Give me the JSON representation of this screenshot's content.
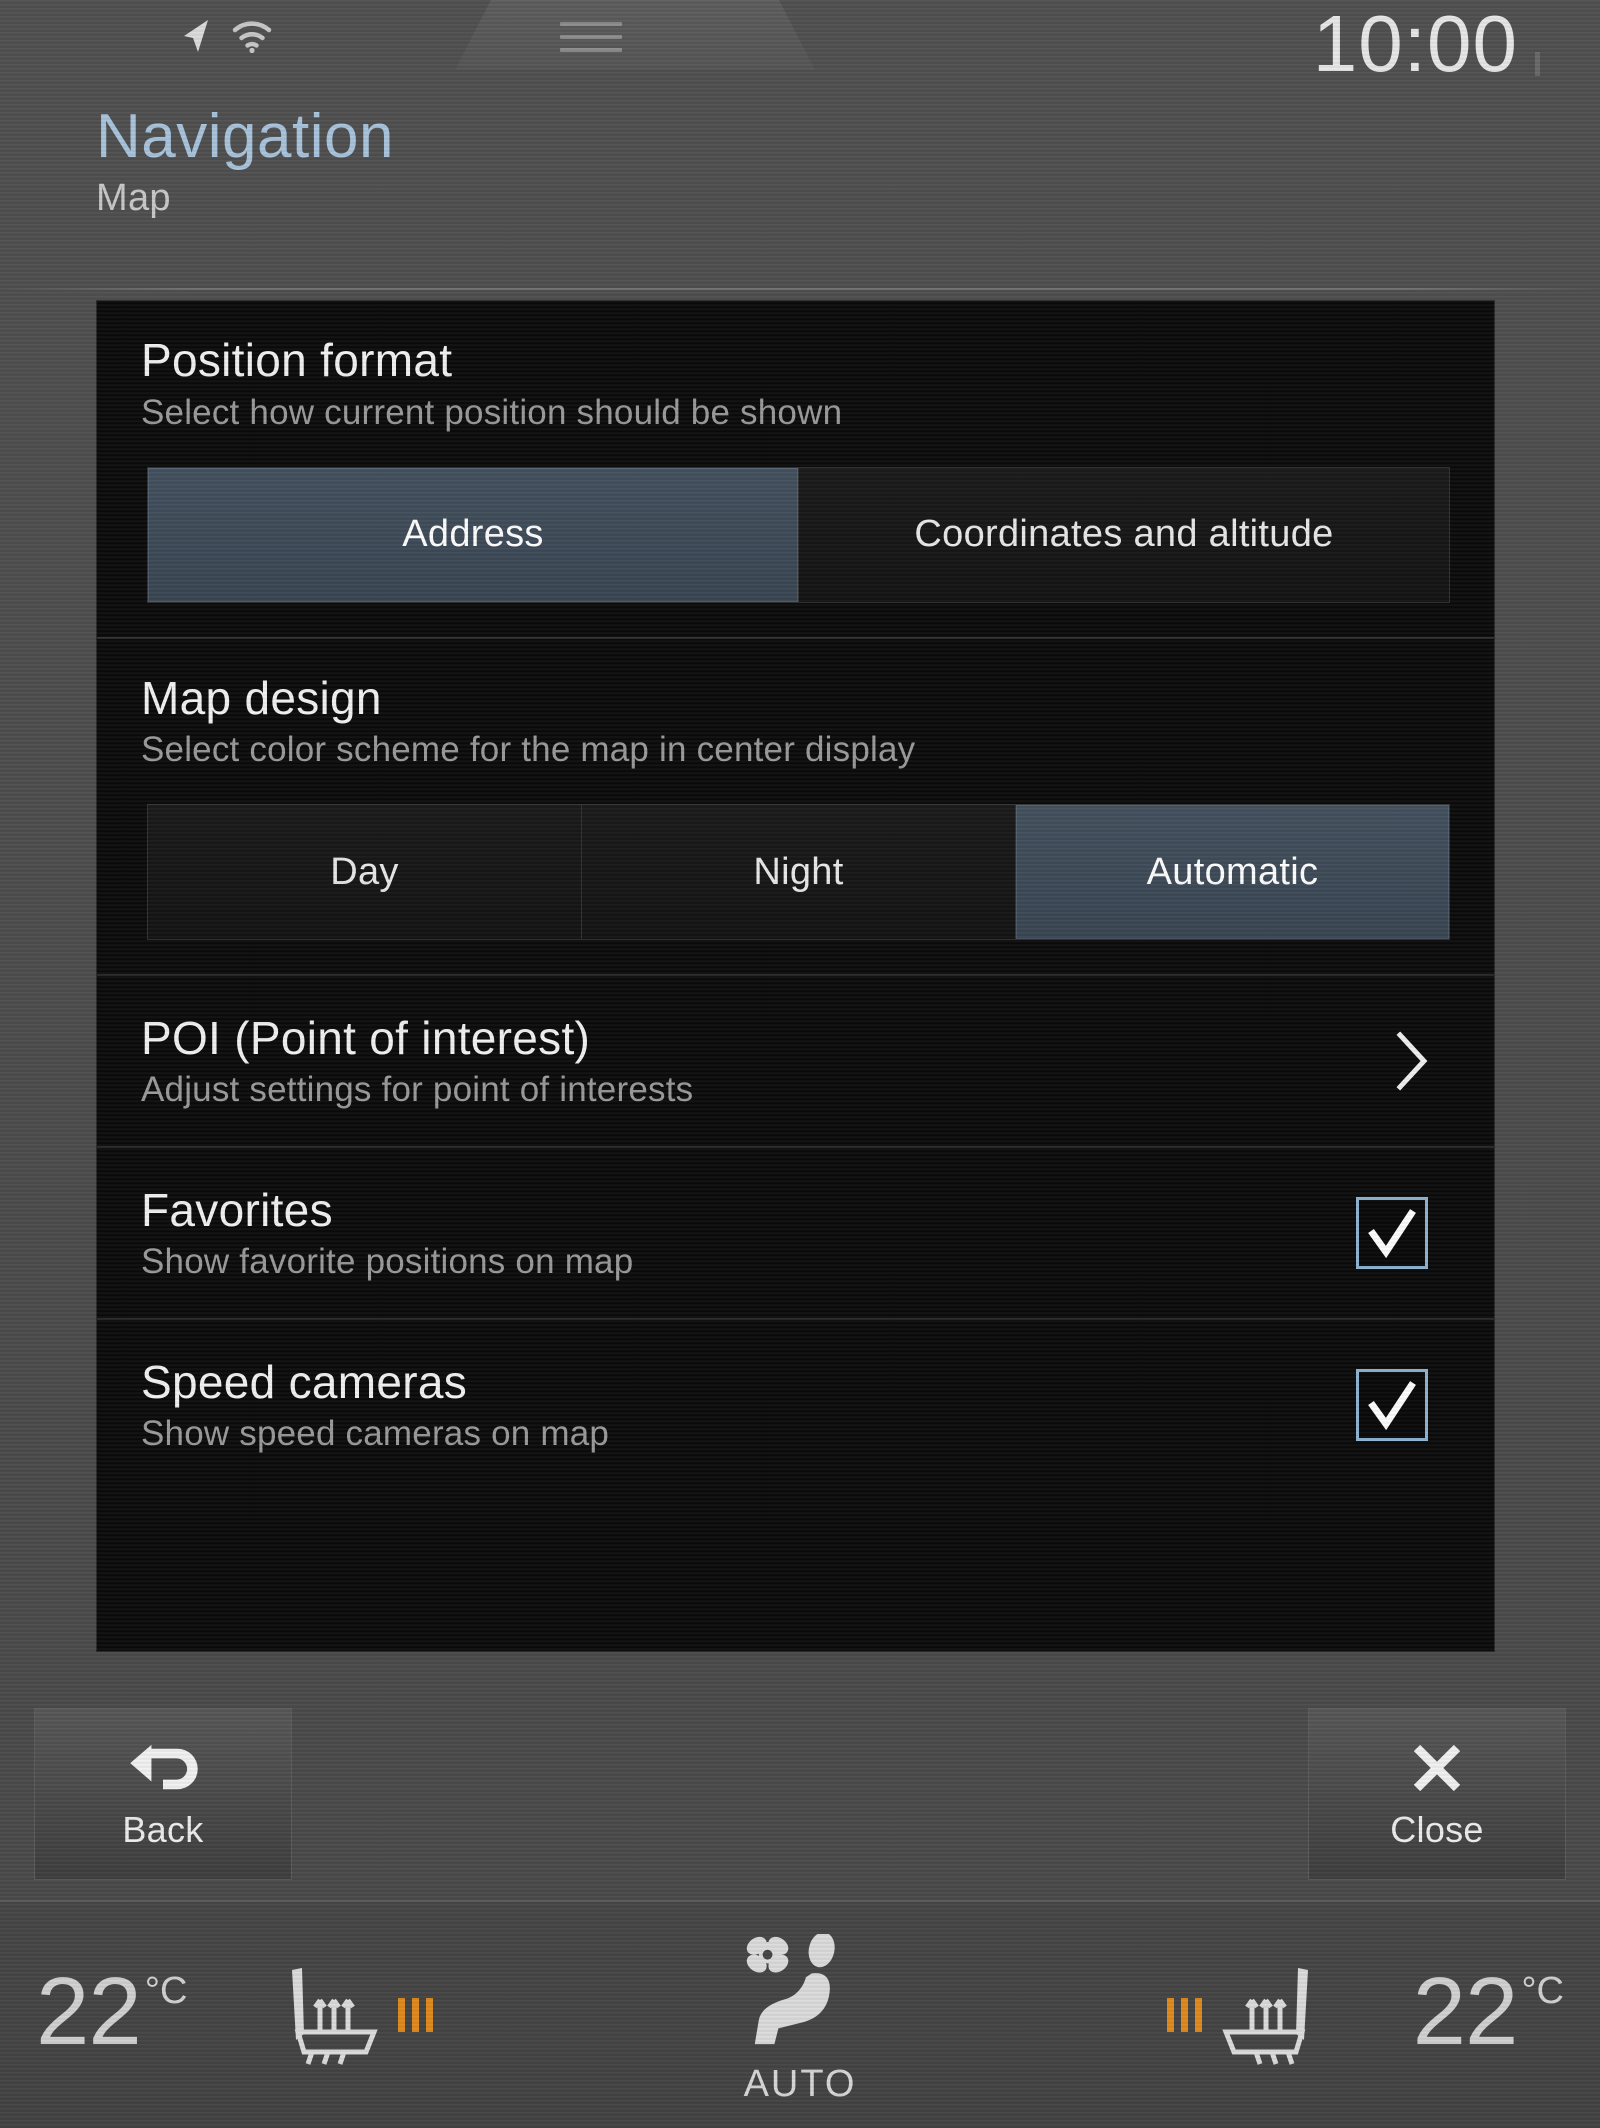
{
  "statusbar": {
    "gps_icon": "navigation-arrow-icon",
    "wifi_icon": "wifi-icon",
    "menu_icon": "hamburger-menu-icon",
    "clock": "10:00"
  },
  "header": {
    "title": "Navigation",
    "subtitle": "Map"
  },
  "settings": {
    "sections": [
      {
        "title": "Position format",
        "description": "Select how current position should be shown",
        "options": [
          {
            "label": "Address",
            "selected": true
          },
          {
            "label": "Coordinates and altitude",
            "selected": false
          }
        ]
      },
      {
        "title": "Map design",
        "description": "Select color scheme for the map in center display",
        "options": [
          {
            "label": "Day",
            "selected": false
          },
          {
            "label": "Night",
            "selected": false
          },
          {
            "label": "Automatic",
            "selected": true
          }
        ]
      }
    ],
    "rows": [
      {
        "title": "POI (Point of interest)",
        "description": "Adjust settings for point of interests",
        "control": "chevron",
        "checked": null
      },
      {
        "title": "Favorites",
        "description": "Show favorite positions on map",
        "control": "checkbox",
        "checked": true
      },
      {
        "title": "Speed cameras",
        "description": "Show speed cameras on map",
        "control": "checkbox",
        "checked": true
      }
    ]
  },
  "buttons": {
    "back": {
      "label": "Back",
      "icon": "back-arrow-icon"
    },
    "close": {
      "label": "Close",
      "icon": "close-x-icon"
    }
  },
  "climate": {
    "left_temperature": "22",
    "left_unit": "°C",
    "right_temperature": "22",
    "right_unit": "°C",
    "left_seat_heat_level": 3,
    "right_seat_heat_level": 3,
    "seat_icon": "heated-seat-icon",
    "auto_label": "AUTO",
    "auto_icon": "fan-seat-auto-icon"
  },
  "colors": {
    "accent_title": "#a8c4dc",
    "selected_segment": "#3e4b5a",
    "checkbox_border": "#8fb4d2",
    "seat_heat_bar": "#e08a1e",
    "panel_bg": "#0b0b0b",
    "screen_bg": "#4e4e4e"
  }
}
